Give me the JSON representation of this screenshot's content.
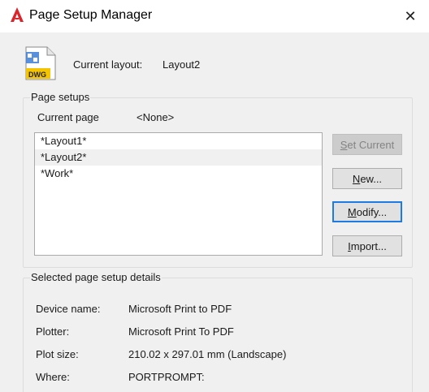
{
  "window": {
    "title": "Page Setup Manager",
    "app_icon": "autocad-a-icon",
    "close_icon": "close-x-icon"
  },
  "current_layout": {
    "icon": "dwg-file-icon",
    "icon_text": "DWG",
    "label": "Current layout:",
    "value": "Layout2"
  },
  "page_setups": {
    "group_title": "Page setups",
    "current_page_label": "Current page",
    "current_page_value": "<None>",
    "items": [
      {
        "label": "*Layout1*",
        "selected": false
      },
      {
        "label": "*Layout2*",
        "selected": true
      },
      {
        "label": "*Work*",
        "selected": false
      }
    ],
    "buttons": {
      "set_current": {
        "mnemonic": "S",
        "rest": "et Current",
        "enabled": false
      },
      "new": {
        "mnemonic": "N",
        "rest": "ew...",
        "enabled": true
      },
      "modify": {
        "mnemonic": "M",
        "rest": "odify...",
        "enabled": true,
        "focused": true
      },
      "import": {
        "mnemonic": "I",
        "rest": "mport...",
        "enabled": true
      }
    }
  },
  "details": {
    "group_title": "Selected page setup details",
    "rows": [
      {
        "label": "Device name:",
        "value": "Microsoft Print to PDF"
      },
      {
        "label": "Plotter:",
        "value": "Microsoft Print To PDF"
      },
      {
        "label": "Plot size:",
        "value": "210.02 x 297.01 mm (Landscape)"
      },
      {
        "label": "Where:",
        "value": "PORTPROMPT:"
      }
    ]
  },
  "colors": {
    "accent": "#1e7be3",
    "autocad_red": "#d9262c",
    "dwg_yellow": "#f5c400"
  }
}
